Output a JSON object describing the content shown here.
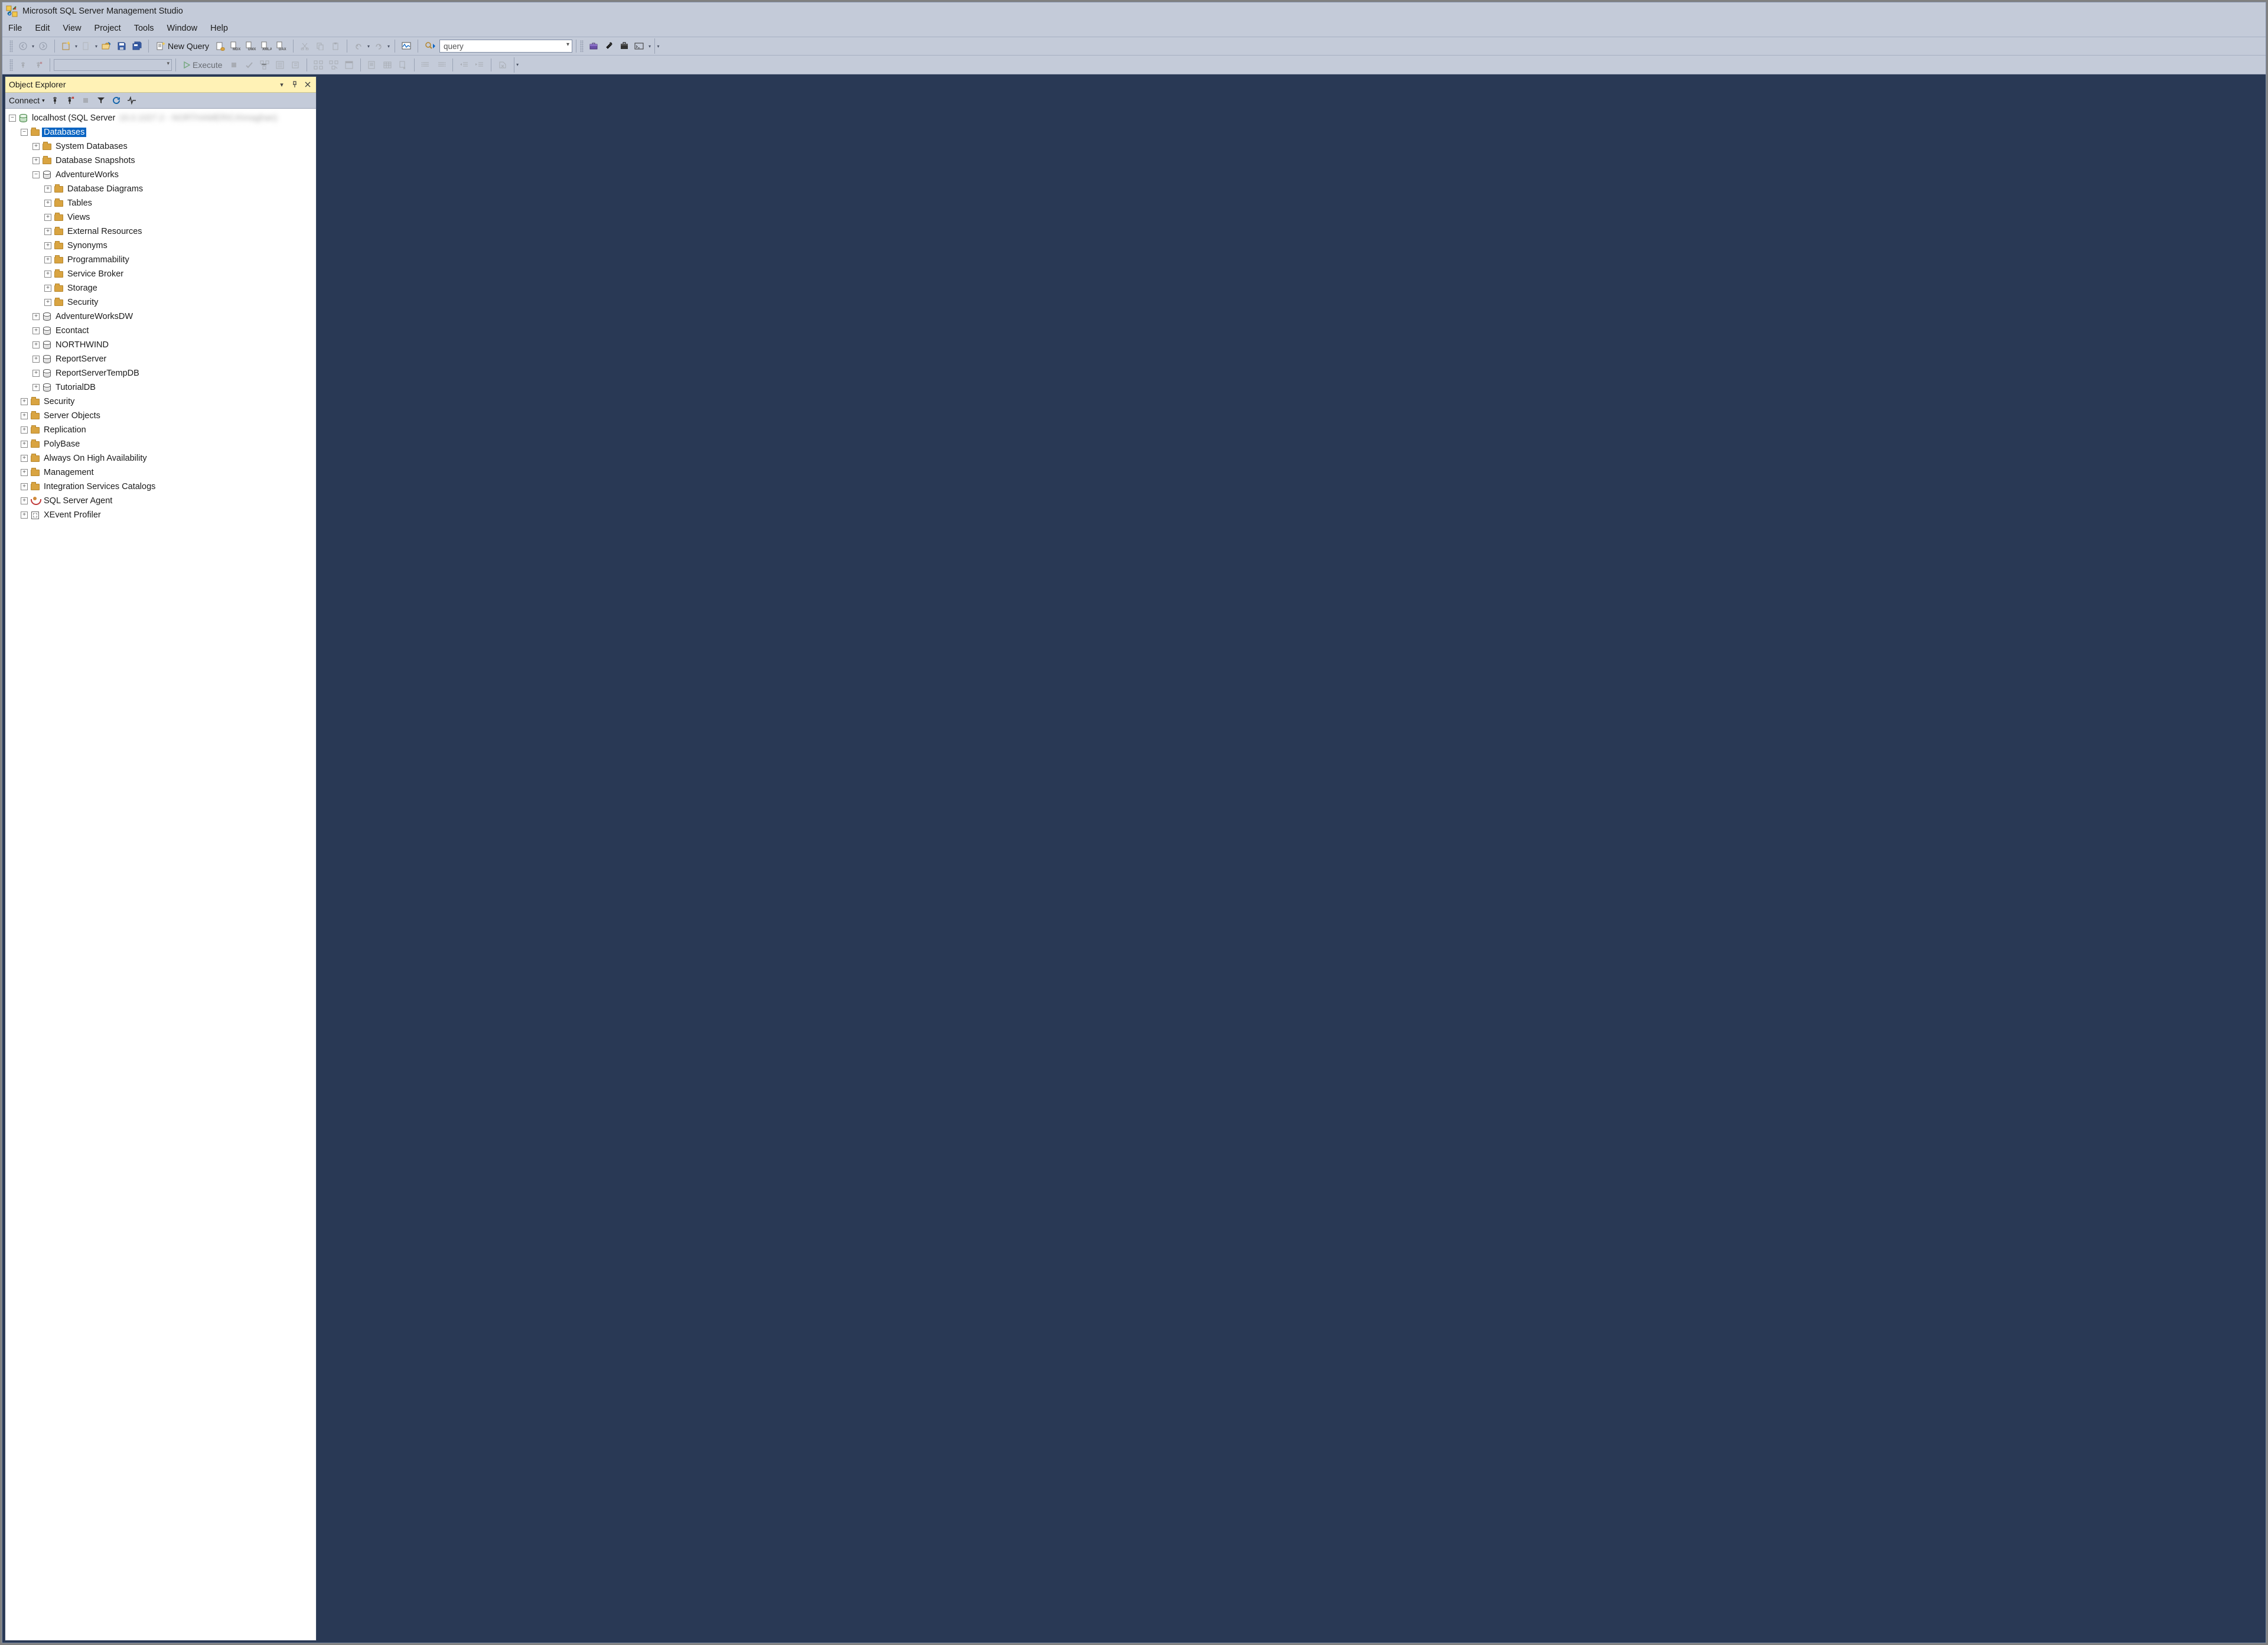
{
  "app": {
    "title": "Microsoft SQL Server Management Studio"
  },
  "menu": {
    "items": [
      "File",
      "Edit",
      "View",
      "Project",
      "Tools",
      "Window",
      "Help"
    ]
  },
  "toolbar1": {
    "new_query": "New Query",
    "quick_launch_value": "query"
  },
  "toolbar2": {
    "execute": "Execute",
    "database_combo": ""
  },
  "object_explorer": {
    "title": "Object Explorer",
    "connect": "Connect",
    "server": {
      "label": "localhost (SQL Server",
      "info_blur": "16.0.1027.2 - NORTHAMERICA\\maghan)"
    },
    "nodes": {
      "databases": "Databases",
      "system_databases": "System Databases",
      "database_snapshots": "Database Snapshots",
      "dbs": [
        {
          "name": "AdventureWorks",
          "expanded": true,
          "children": [
            "Database Diagrams",
            "Tables",
            "Views",
            "External Resources",
            "Synonyms",
            "Programmability",
            "Service Broker",
            "Storage",
            "Security"
          ]
        },
        {
          "name": "AdventureWorksDW",
          "expanded": false
        },
        {
          "name": "Econtact",
          "expanded": false
        },
        {
          "name": "NORTHWIND",
          "expanded": false
        },
        {
          "name": "ReportServer",
          "expanded": false
        },
        {
          "name": "ReportServerTempDB",
          "expanded": false
        },
        {
          "name": "TutorialDB",
          "expanded": false
        }
      ],
      "server_nodes": [
        "Security",
        "Server Objects",
        "Replication",
        "PolyBase",
        "Always On High Availability",
        "Management",
        "Integration Services Catalogs"
      ],
      "sql_agent": "SQL Server Agent",
      "xevent": "XEvent Profiler"
    }
  }
}
